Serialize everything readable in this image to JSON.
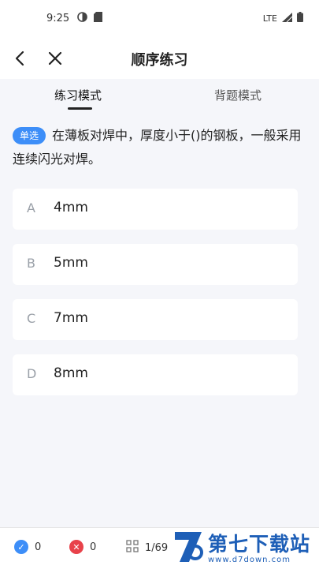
{
  "status": {
    "time": "9:25",
    "network": "LTE"
  },
  "nav": {
    "title": "顺序练习"
  },
  "tabs": [
    {
      "label": "练习模式",
      "active": true
    },
    {
      "label": "背题模式",
      "active": false
    }
  ],
  "question": {
    "type_badge": "单选",
    "text": "在薄板对焊中，厚度小于()的钢板，一般采用连续闪光对焊。"
  },
  "options": [
    {
      "letter": "A",
      "text": "4mm"
    },
    {
      "letter": "B",
      "text": "5mm"
    },
    {
      "letter": "C",
      "text": "7mm"
    },
    {
      "letter": "D",
      "text": "8mm"
    }
  ],
  "bottom": {
    "correct_count": "0",
    "wrong_count": "0",
    "progress": "1/69"
  },
  "watermark": {
    "title": "第七下载站",
    "url": "www.d7down.com"
  },
  "colors": {
    "accent": "#3d8ef8",
    "correct": "#3d8ef8",
    "wrong": "#e8424a",
    "brand": "#1e5fb7"
  }
}
